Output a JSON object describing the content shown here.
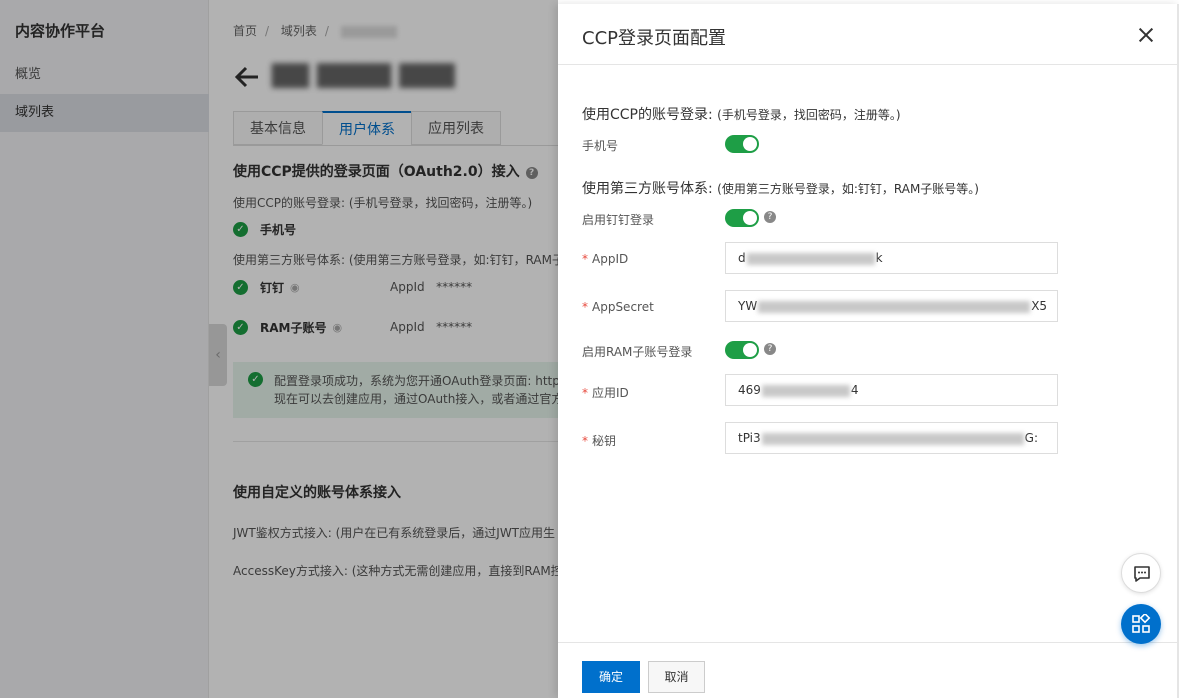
{
  "sidebar": {
    "title": "内容协作平台",
    "items": [
      {
        "label": "概览"
      },
      {
        "label": "域列表"
      }
    ]
  },
  "breadcrumb": {
    "home": "首页",
    "sep": "/",
    "domains": "域列表"
  },
  "page": {
    "tabs": [
      {
        "label": "基本信息"
      },
      {
        "label": "用户体系"
      },
      {
        "label": "应用列表"
      }
    ],
    "section1_title": "使用CCP提供的登录页面（OAuth2.0）接入",
    "ccp_account_text": "使用CCP的账号登录: (手机号登录，找回密码，注册等。)",
    "phone_label": "手机号",
    "third_party_text": "使用第三方账号体系: (使用第三方账号登录，如:钉钉，RAM子",
    "dingtalk_label": "钉钉",
    "ram_label": "RAM子账号",
    "appid_label": "AppId",
    "appid_mask": "******",
    "success_line1": "配置登录项成功，系统为您开通OAuth登录页面: https",
    "success_line2": "现在可以去创建应用，通过OAuth接入，或者通过官方",
    "section2_title": "使用自定义的账号体系接入",
    "jwt_text": "JWT鉴权方式接入: (用户在已有系统登录后，通过JWT应用生",
    "accesskey_text": "AccessKey方式接入: (这种方式无需创建应用，直接到RAM控制"
  },
  "drawer": {
    "title": "CCP登录页面配置",
    "group1_title": "使用CCP的账号登录:",
    "group1_hint": "(手机号登录，找回密码，注册等。)",
    "phone_label": "手机号",
    "group2_title": "使用第三方账号体系:",
    "group2_hint": "(使用第三方账号登录，如:钉钉，RAM子账号等。)",
    "dingtalk_toggle_label": "启用钉钉登录",
    "appid_label": "AppID",
    "appid_prefix": "d",
    "appid_suffix": "k",
    "appsecret_label": "AppSecret",
    "appsecret_prefix": "YW",
    "appsecret_suffix": "X5",
    "ram_toggle_label": "启用RAM子账号登录",
    "app_id_label": "应用ID",
    "app_id_prefix": "469",
    "app_id_suffix": "4",
    "secret_label": "秘钥",
    "secret_prefix": "tPi3",
    "secret_suffix": "G:",
    "toggles": {
      "phone": true,
      "dingtalk": true,
      "ram": true
    },
    "ok_label": "确定",
    "cancel_label": "取消"
  },
  "colors": {
    "primary": "#0070cc",
    "success": "#1e9e46",
    "required": "#e84a3e",
    "brand": "#ff6a00"
  }
}
